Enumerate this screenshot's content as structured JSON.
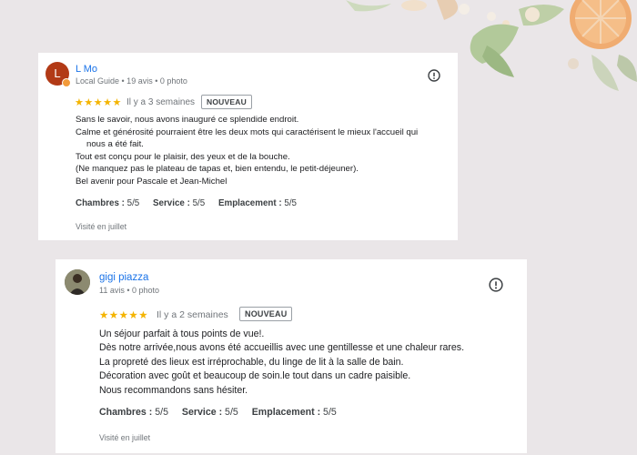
{
  "reviews": [
    {
      "reviewer_name": "L Mo",
      "avatar_letter": "L",
      "reviewer_meta": "Local Guide • 19 avis • 0 photo",
      "stars": "★★★★★",
      "time": "Il y a 3 semaines",
      "badge": "NOUVEAU",
      "lines": [
        "Sans le savoir, nous avons inauguré ce splendide endroit.",
        "Calme et générosité pourraient être les deux mots qui caractérisent le mieux l'accueil qui",
        "nous a été fait.",
        "Tout est conçu pour le plaisir, des yeux et de la bouche.",
        "(Ne manquez pas le plateau de tapas et, bien entendu, le petit-déjeuner).",
        "Bel avenir pour Pascale et Jean-Michel"
      ],
      "ratings": [
        {
          "label": "Chambres :",
          "value": "5/5"
        },
        {
          "label": "Service :",
          "value": "5/5"
        },
        {
          "label": "Emplacement :",
          "value": "5/5"
        }
      ],
      "visited": "Visité en juillet"
    },
    {
      "reviewer_name": "gigi piazza",
      "reviewer_meta": "11 avis • 0 photo",
      "stars": "★★★★★",
      "time": "Il y a 2 semaines",
      "badge": "NOUVEAU",
      "lines": [
        "Un séjour parfait à tous points de vue!.",
        "Dès notre arrivée,nous avons été accueillis avec une gentillesse et une chaleur rares.",
        "La propreté des lieux est irréprochable, du linge de lit à la salle de bain.",
        "Décoration avec goût et beaucoup de soin.le tout dans un cadre paisible.",
        "Nous recommandons sans hésiter."
      ],
      "ratings": [
        {
          "label": "Chambres :",
          "value": "5/5"
        },
        {
          "label": "Service :",
          "value": "5/5"
        },
        {
          "label": "Emplacement :",
          "value": "5/5"
        }
      ],
      "visited": "Visité en juillet"
    }
  ],
  "colors": {
    "background": "#eae6e8",
    "link_blue": "#1a73e8",
    "star_gold": "#f4b400",
    "avatar_l": "#b23a16"
  },
  "icons": {
    "info": "info-circle-icon",
    "decoration": "orange-floral-decoration"
  }
}
